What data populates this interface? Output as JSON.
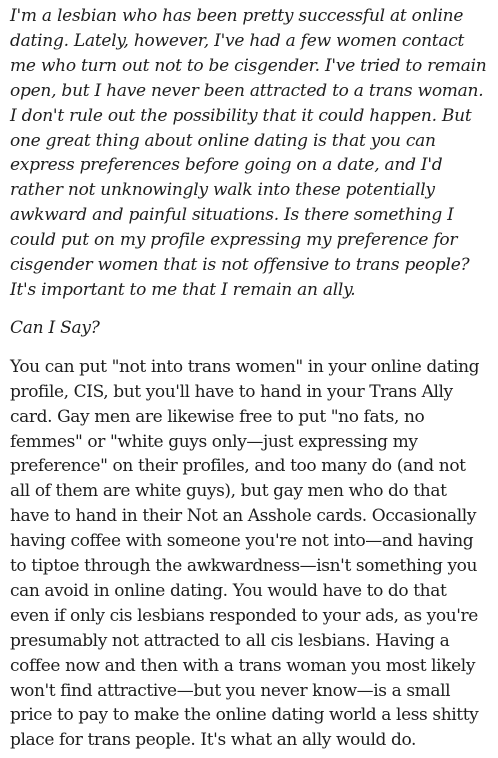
{
  "letter": {
    "question": "I'm a lesbian who has been pretty successful at online dating. Lately, however, I've had a few women contact me who turn out not to be cisgender. I've tried to remain open, but I have never been attracted to a trans woman. I don't rule out the possibility that it could happen. But one great thing about online dating is that you can express preferences before going on a date, and I'd rather not unknowingly walk into these potentially awkward and painful situations. Is there something I could put on my profile expressing my preference for cisgender women that is not offensive to trans people? It's important to me that I remain an ally.",
    "signoff": "Can I Say?"
  },
  "response": {
    "answer": "You can put \"not into trans women\" in your online dating profile, CIS, but you'll have to hand in your Trans Ally card. Gay men are likewise free to put \"no fats, no femmes\" or \"white guys only—just expressing my preference\" on their profiles, and too many do (and not all of them are white guys), but gay men who do that have to hand in their Not an Asshole cards. Occasionally having coffee with someone you're not into—and having to tiptoe through the awkwardness—isn't something you can avoid in online dating. You would have to do that even if only cis lesbians responded to your ads, as you're presumably not attracted to all cis lesbians. Having a coffee now and then with a trans woman you most likely won't find attractive—but you never know—is a small price to pay to make the online dating world a less shitty place for trans people. It's what an ally would do."
  }
}
